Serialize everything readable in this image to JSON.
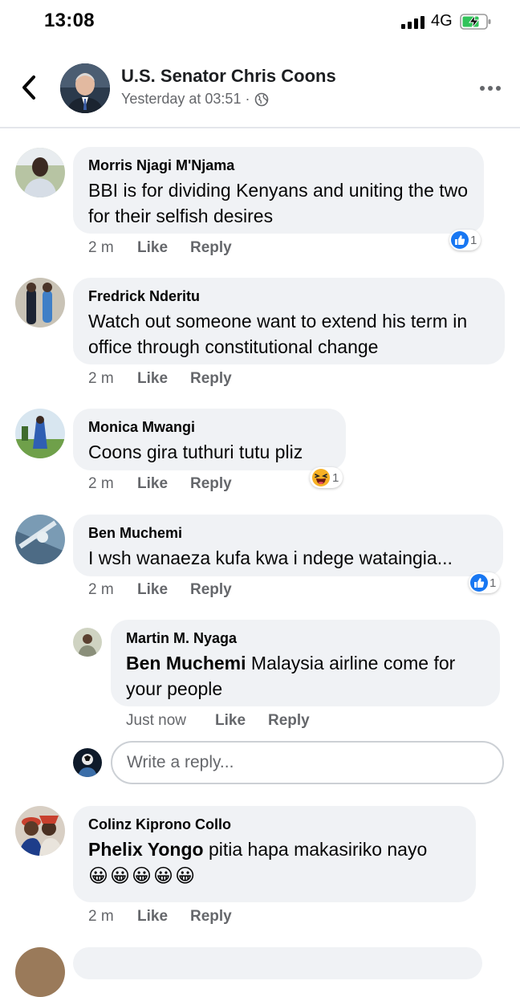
{
  "status_bar": {
    "time": "13:08",
    "network": "4G"
  },
  "header": {
    "title": "U.S. Senator Chris Coons",
    "subtitle": "Yesterday at 03:51 ·",
    "back_icon": "chevron-left-icon",
    "more_icon": "more-horizontal-icon",
    "privacy_icon": "globe-icon"
  },
  "comments": [
    {
      "author": "Morris Njagi M'Njama",
      "text": "BBI is for dividing Kenyans and uniting the two for their selfish desires",
      "time": "2 m",
      "like": "Like",
      "reply": "Reply",
      "reaction": "like",
      "reaction_count": "1"
    },
    {
      "author": "Fredrick Nderitu",
      "text": "Watch out someone want to extend his term in office through constitutional change",
      "time": "2 m",
      "like": "Like",
      "reply": "Reply"
    },
    {
      "author": "Monica Mwangi",
      "text": "Coons gira tuthuri tutu pliz",
      "time": "2 m",
      "like": "Like",
      "reply": "Reply",
      "reaction": "haha",
      "reaction_count": "1"
    },
    {
      "author": "Ben Muchemi",
      "text": "I wsh wanaeza kufa kwa i ndege wataingia...",
      "time": "2 m",
      "like": "Like",
      "reply": "Reply",
      "reaction": "like",
      "reaction_count": "1"
    }
  ],
  "reply": {
    "author": "Martin M. Nyaga",
    "mention": "Ben Muchemi",
    "text": " Malaysia airline come for your people",
    "time": "Just now",
    "like": "Like",
    "reply": "Reply"
  },
  "write_reply": {
    "placeholder": "Write a reply..."
  },
  "last_comment": {
    "author": "Colinz Kiprono Collo",
    "mention": "Phelix Yongo",
    "text": " pitia hapa  makasiriko nayo",
    "emojis": "😀😀😀😀😀",
    "time": "2 m",
    "like": "Like",
    "reply": "Reply"
  },
  "colors": {
    "accent": "#1877f2",
    "bubble": "#f0f2f5",
    "meta": "#65676b"
  }
}
